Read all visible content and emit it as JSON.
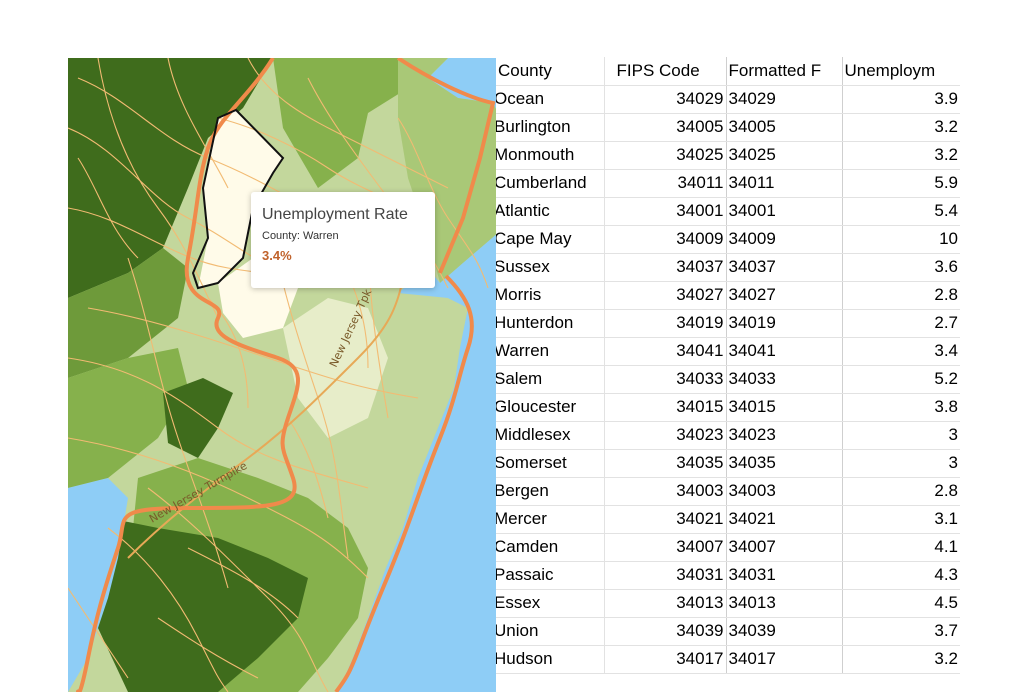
{
  "map": {
    "road_labels": [
      "New Jersey Tpk",
      "New Jersey Turnpike"
    ],
    "colors": {
      "water": "#8ecdf6",
      "dark_green": "#3f6c1c",
      "mid_green": "#86b14c",
      "light_green": "#c3d79c",
      "pale_green": "#e7edc9",
      "highlight": "#fffbe9",
      "roads": "#f2bb73",
      "state_border": "#f08a4b",
      "county_outline": "#111111"
    }
  },
  "tooltip": {
    "title": "Unemployment Rate",
    "county_line": "County: Warren",
    "value": "3.4%"
  },
  "sheet": {
    "headers": [
      "County",
      "FIPS Code",
      "Formatted F",
      "Unemploym"
    ],
    "rows": [
      [
        "Ocean",
        "34029",
        "34029",
        "3.9"
      ],
      [
        "Burlington",
        "34005",
        "34005",
        "3.2"
      ],
      [
        "Monmouth",
        "34025",
        "34025",
        "3.2"
      ],
      [
        "Cumberland",
        "34011",
        "34011",
        "5.9"
      ],
      [
        "Atlantic",
        "34001",
        "34001",
        "5.4"
      ],
      [
        "Cape May",
        "34009",
        "34009",
        "10"
      ],
      [
        "Sussex",
        "34037",
        "34037",
        "3.6"
      ],
      [
        "Morris",
        "34027",
        "34027",
        "2.8"
      ],
      [
        "Hunterdon",
        "34019",
        "34019",
        "2.7"
      ],
      [
        "Warren",
        "34041",
        "34041",
        "3.4"
      ],
      [
        "Salem",
        "34033",
        "34033",
        "5.2"
      ],
      [
        "Gloucester",
        "34015",
        "34015",
        "3.8"
      ],
      [
        "Middlesex",
        "34023",
        "34023",
        "3"
      ],
      [
        "Somerset",
        "34035",
        "34035",
        "3"
      ],
      [
        "Bergen",
        "34003",
        "34003",
        "2.8"
      ],
      [
        "Mercer",
        "34021",
        "34021",
        "3.1"
      ],
      [
        "Camden",
        "34007",
        "34007",
        "4.1"
      ],
      [
        "Passaic",
        "34031",
        "34031",
        "4.3"
      ],
      [
        "Essex",
        "34013",
        "34013",
        "4.5"
      ],
      [
        "Union",
        "34039",
        "34039",
        "3.7"
      ],
      [
        "Hudson",
        "34017",
        "34017",
        "3.2"
      ]
    ]
  }
}
